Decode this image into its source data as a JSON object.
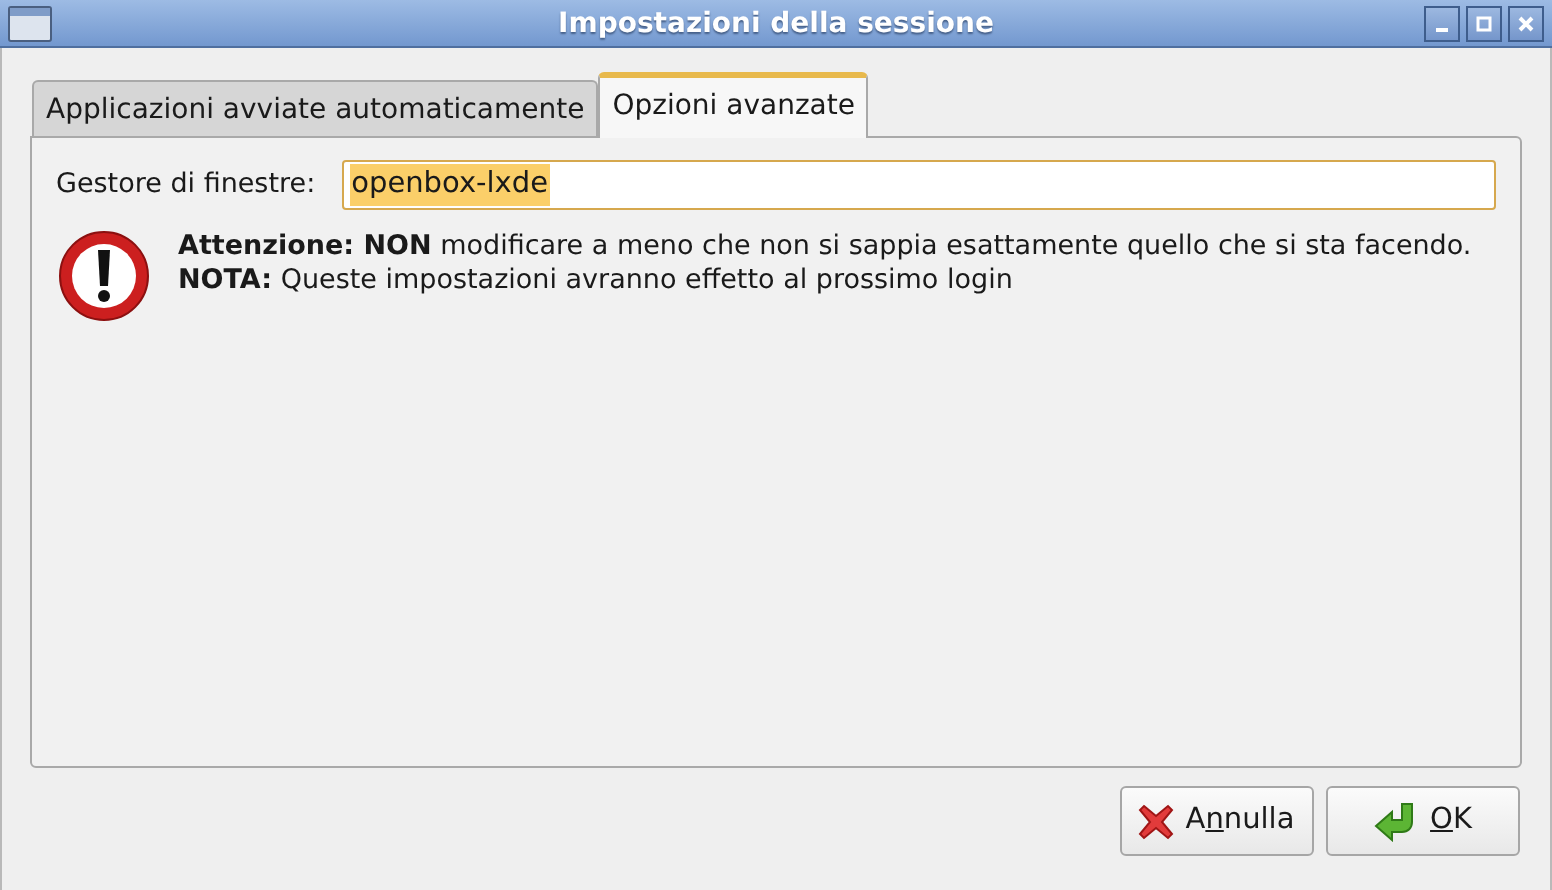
{
  "window": {
    "title": "Impostazioni della sessione"
  },
  "tabs": [
    {
      "label": "Applicazioni avviate automaticamente",
      "selected": false
    },
    {
      "label": "Opzioni avanzate",
      "selected": true
    }
  ],
  "window_manager": {
    "label": "Gestore di finestre:",
    "value": "openbox-lxde",
    "text_selected": true
  },
  "warning": {
    "lines": [
      "**Attenzione: NON** modificare a meno che non si sappia esattamente quello che si sta facendo.",
      "**NOTA:** Queste impostazioni avranno effetto al prossimo login"
    ]
  },
  "buttons": [
    {
      "kind": "cancel",
      "before": "A",
      "mnemonic": "n",
      "after": "nulla"
    },
    {
      "kind": "ok",
      "mnemonic": "O",
      "after": "K"
    }
  ]
}
